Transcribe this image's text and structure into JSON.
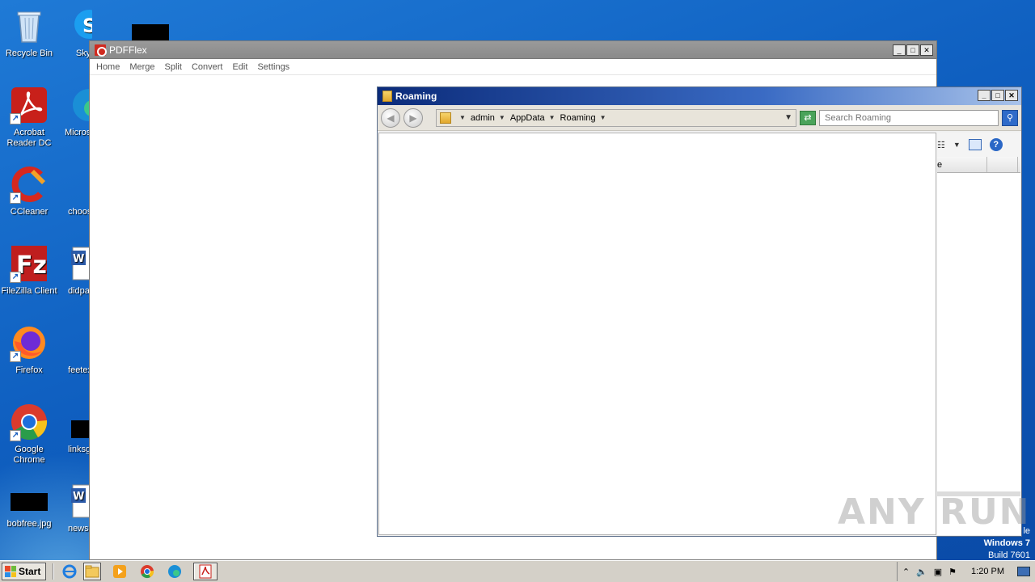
{
  "desktop": {
    "icons": [
      {
        "label": "Recycle Bin",
        "icon": "recycle-bin-icon"
      },
      {
        "label": "Acrobat Reader DC",
        "icon": "acrobat-reader-icon"
      },
      {
        "label": "CCleaner",
        "icon": "ccleaner-icon"
      },
      {
        "label": "FileZilla Client",
        "icon": "filezilla-icon"
      },
      {
        "label": "Firefox",
        "icon": "firefox-icon"
      },
      {
        "label": "Google Chrome",
        "icon": "chrome-icon"
      },
      {
        "label": "bobfree.jpg",
        "icon": "image-file-icon"
      },
      {
        "label": "Sky",
        "icon": "skype-icon"
      },
      {
        "label": "Microso",
        "icon": "edge-icon"
      },
      {
        "label": "choose",
        "icon": "file-icon"
      },
      {
        "label": "didpap",
        "icon": "word-doc-icon"
      },
      {
        "label": "feetex",
        "icon": "file-icon"
      },
      {
        "label": "linksgl",
        "icon": "file-icon"
      },
      {
        "label": "newsle",
        "icon": "word-doc-icon"
      }
    ]
  },
  "pdfflex": {
    "title": "PDFFlex",
    "menu": [
      "Home",
      "Merge",
      "Split",
      "Convert",
      "Edit",
      "Settings"
    ]
  },
  "explorer": {
    "title": "Roaming",
    "breadcrumb": [
      "admin",
      "AppData",
      "Roaming"
    ],
    "search_placeholder": "Search Roaming",
    "column_partial": "e"
  },
  "watermark": "ANY RUN",
  "windows_version": {
    "line1": "le",
    "line2": "Windows 7",
    "line3": "Build 7601"
  },
  "taskbar": {
    "start_label": "Start",
    "clock": "1:20 PM"
  },
  "colors": {
    "desktop_blue": "#1565c0",
    "explorer_title": "#0b2b7a",
    "pdf_red": "#d02b20"
  }
}
